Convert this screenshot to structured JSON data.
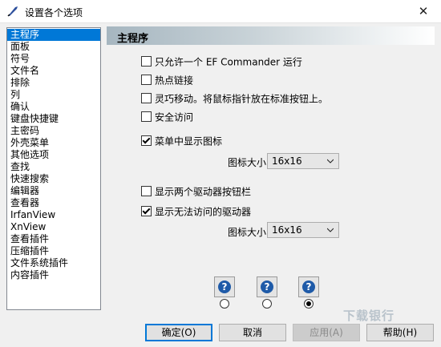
{
  "window": {
    "title": "设置各个选项",
    "close_glyph": "✕"
  },
  "sidebar": {
    "items": [
      {
        "label": "主程序",
        "active": true
      },
      {
        "label": "面板"
      },
      {
        "label": "符号"
      },
      {
        "label": "文件名"
      },
      {
        "label": "排除"
      },
      {
        "label": "列"
      },
      {
        "label": "确认"
      },
      {
        "label": "键盘快捷键"
      },
      {
        "label": "主密码"
      },
      {
        "label": "外壳菜单"
      },
      {
        "label": "其他选项"
      },
      {
        "label": "查找"
      },
      {
        "label": "快速搜索"
      },
      {
        "label": "编辑器"
      },
      {
        "label": "查看器"
      },
      {
        "label": "IrfanView"
      },
      {
        "label": "XnView"
      },
      {
        "label": "查看插件"
      },
      {
        "label": "压缩插件"
      },
      {
        "label": "文件系统插件"
      },
      {
        "label": "内容插件"
      }
    ]
  },
  "panel": {
    "title": "主程序",
    "options": {
      "single_instance": {
        "label": "只允许一个 EF Commander 运行",
        "checked": false
      },
      "hotspot_links": {
        "label": "热点链接",
        "checked": false
      },
      "smart_move": {
        "label": "灵巧移动。将鼠标指针放在标准按钮上。",
        "checked": false
      },
      "secure_access": {
        "label": "安全访问",
        "checked": false
      },
      "show_icons_in_menu": {
        "label": "菜单中显示图标",
        "checked": true
      },
      "show_two_drive_bars": {
        "label": "显示两个驱动器按钮栏",
        "checked": false
      },
      "show_inaccessible_drives": {
        "label": "显示无法访问的驱动器",
        "checked": true
      }
    },
    "icon_size_1": {
      "label": "图标大小",
      "value": "16x16"
    },
    "icon_size_2": {
      "label": "图标大小",
      "value": "16x16"
    },
    "help_style_selected": 3
  },
  "buttons": {
    "ok": "确定(O)",
    "cancel": "取消",
    "apply": "应用(A)",
    "help": "帮助(H)"
  },
  "watermark": "下载银行",
  "colors": {
    "selection": "#0078d7",
    "default_button_border": "#0078d7",
    "help_icon": "#1e5aa8"
  }
}
